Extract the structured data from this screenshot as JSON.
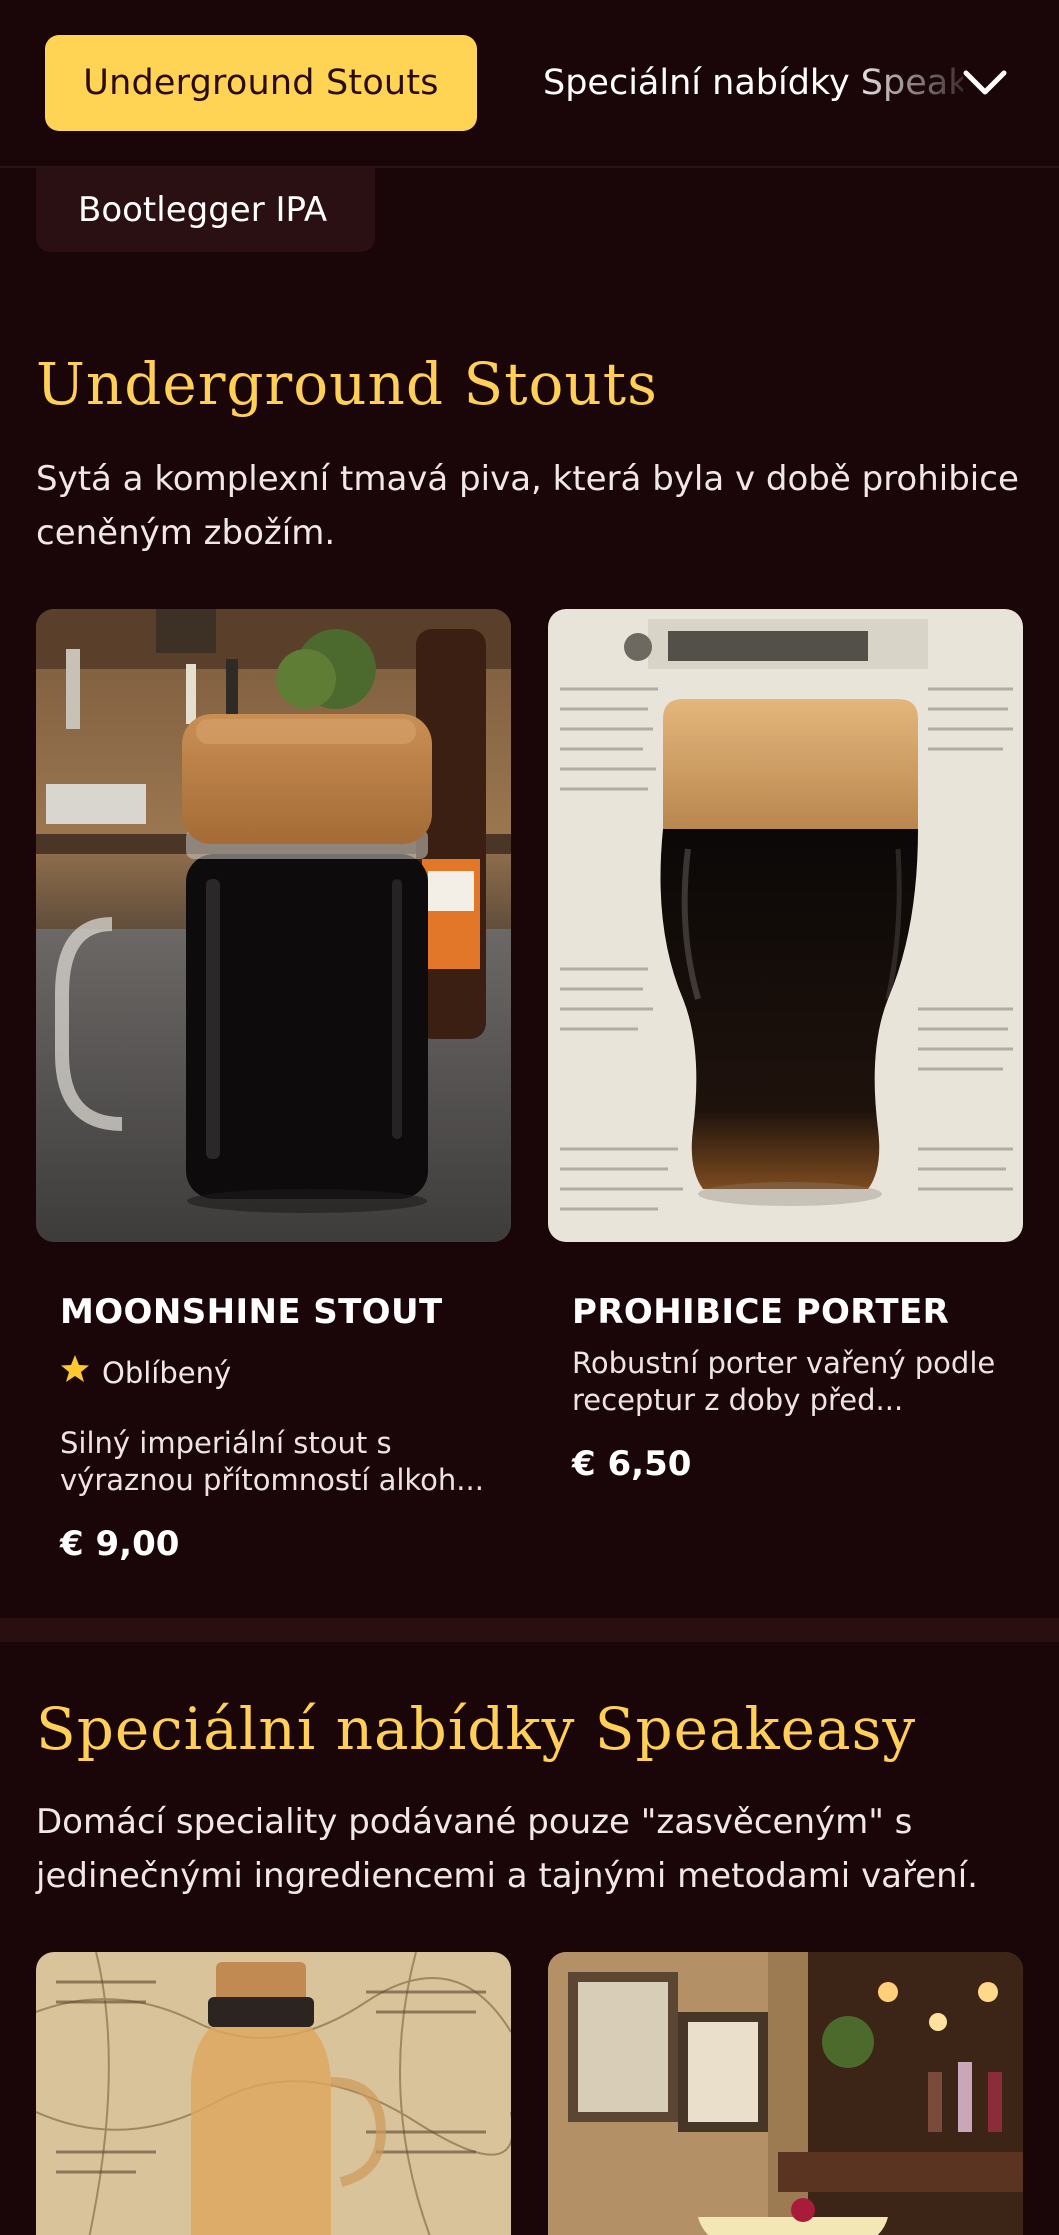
{
  "nav": {
    "active_label": "Underground Stouts",
    "next_label": "Speciální nabídky Speakeasy",
    "colors": {
      "active_bg": "#ffd454",
      "page_bg": "#1a0608"
    }
  },
  "prev_category": {
    "label": "Bootlegger IPA"
  },
  "sections": [
    {
      "title": "Underground Stouts",
      "description": "Sytá a komplexní tmavá piva, která byla v době prohibice ceněným zbožím.",
      "items": [
        {
          "name": "MOONSHINE STOUT",
          "badge": "Oblíbený",
          "badge_icon": "star-icon",
          "description": "Silný imperiální stout s výraznou přítomností alkoh...",
          "price": "€ 9,00"
        },
        {
          "name": "PROHIBICE PORTER",
          "description": "Robustní porter vařený podle receptur z doby před...",
          "price": "€ 6,50"
        }
      ]
    },
    {
      "title": "Speciální nabídky Speakeasy",
      "description": "Domácí speciality podávané pouze \"zasvěceným\" s jedinečnými ingrediencemi a tajnými metodami vaření."
    }
  ],
  "accent_color": "#ffcf58"
}
